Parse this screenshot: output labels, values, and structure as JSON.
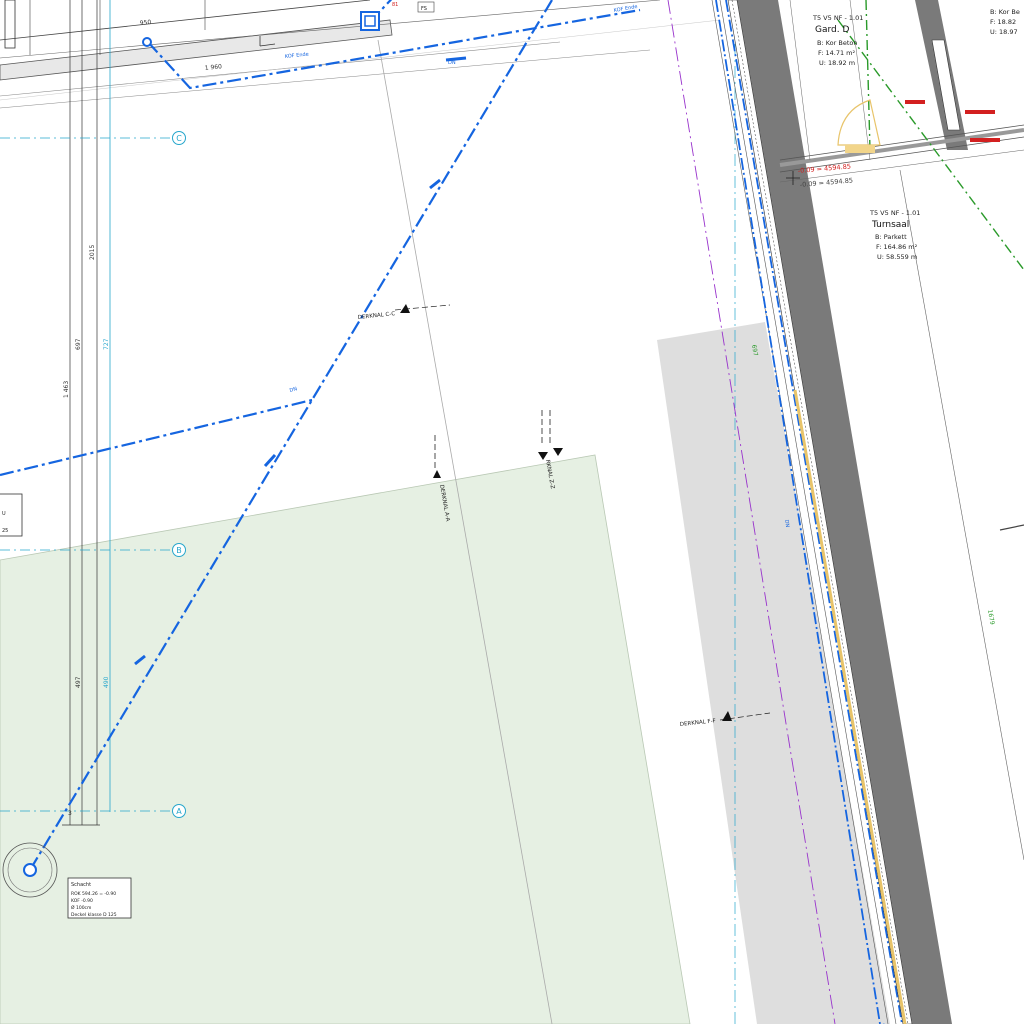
{
  "colors": {
    "pipe_blue": "#1565e0",
    "grid_cyan": "#26a6cc",
    "wall_gray": "#7a7a7a",
    "green_area": "#e6f0e3",
    "gray_area": "#dedede",
    "magenta_line": "#9933cc",
    "green_line": "#2a9a2a",
    "red_text": "#d32020",
    "insulation_yellow": "#e8c46a"
  },
  "axes": {
    "axis_c": "C",
    "axis_b": "B",
    "axis_a": "A"
  },
  "dimensions": {
    "d1": "1 960",
    "d2": "2015",
    "d3": "697",
    "d4": "727",
    "d5": "1 463",
    "d6": "497",
    "d7": "490",
    "d8": "950",
    "d9": "1679",
    "d10": "3",
    "d11": "697"
  },
  "sections": {
    "cc": "DERKNAL C-C",
    "aa": "DERKNAL A-A",
    "zz": "RKNAL Z-Z",
    "ff": "DERKNAL F-F"
  },
  "pipe_labels": {
    "p1": "KOF Ende",
    "p2": "DN",
    "p3": "DN",
    "p4": "DN",
    "p5": "KOF Ende"
  },
  "rooms": {
    "room1": {
      "code": "T5 V5 NF - 1.01",
      "name": "Gard. D",
      "boden": "B: Kor Beton",
      "flaeche": "F: 14.71 m²",
      "umfang": "U: 18.92 m"
    },
    "room2": {
      "code": "T5 V5 NF - 1.01",
      "name": "Turnsaal",
      "boden": "B: Parkett",
      "flaeche": "F: 164.86 m²",
      "umfang": "U: 58.559 m"
    },
    "room3": {
      "boden": "B: Kor Be",
      "flaeche": "F: 18.82",
      "umfang": "U: 18.97"
    }
  },
  "levels": {
    "lvl1": "-0.09 = 4594.85",
    "lvl2": "-0.09 = 4594.85"
  },
  "schacht": {
    "title": "Schacht",
    "l1": "ROK 594.26 = -0.90",
    "l2": "KOF -0.90",
    "l3": "Ø 100cm",
    "l4": "Deckel klasse D 125"
  },
  "left_box": {
    "l1": "U",
    "l2": "25"
  },
  "misc": {
    "red_small_1": "FS",
    "red_small_2": "81",
    "bottom_right": "Sü"
  }
}
